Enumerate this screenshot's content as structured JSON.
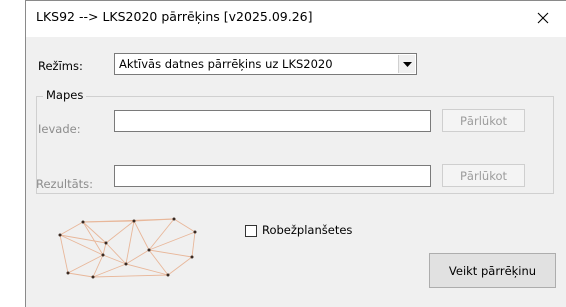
{
  "window": {
    "title": "LKS92 --> LKS2020 pārrēķins [v2025.09.26]",
    "close_glyph": "✕"
  },
  "mode": {
    "label": "Režīms:",
    "selected_value": "Aktīvās datnes pārrēķins uz LKS2020"
  },
  "folders": {
    "group_title": "Mapes",
    "input_label": "Ievade:",
    "input_value": "",
    "input_browse_label": "Pārlūkot",
    "result_label": "Rezultāts:",
    "result_value": "",
    "result_browse_label": "Pārlūkot"
  },
  "options": {
    "border_sheets_label": "Robežplanšetes",
    "border_sheets_checked": false
  },
  "actions": {
    "execute_label": "Veikt pārrēķinu"
  },
  "colors": {
    "window_bg": "#f0f0f0",
    "logo_lines": "#e8b79a",
    "logo_points": "#3a2a22"
  },
  "icons": {
    "close": "close-icon",
    "dropdown": "dropdown-arrow-icon",
    "logo": "triangulation-network-logo"
  }
}
